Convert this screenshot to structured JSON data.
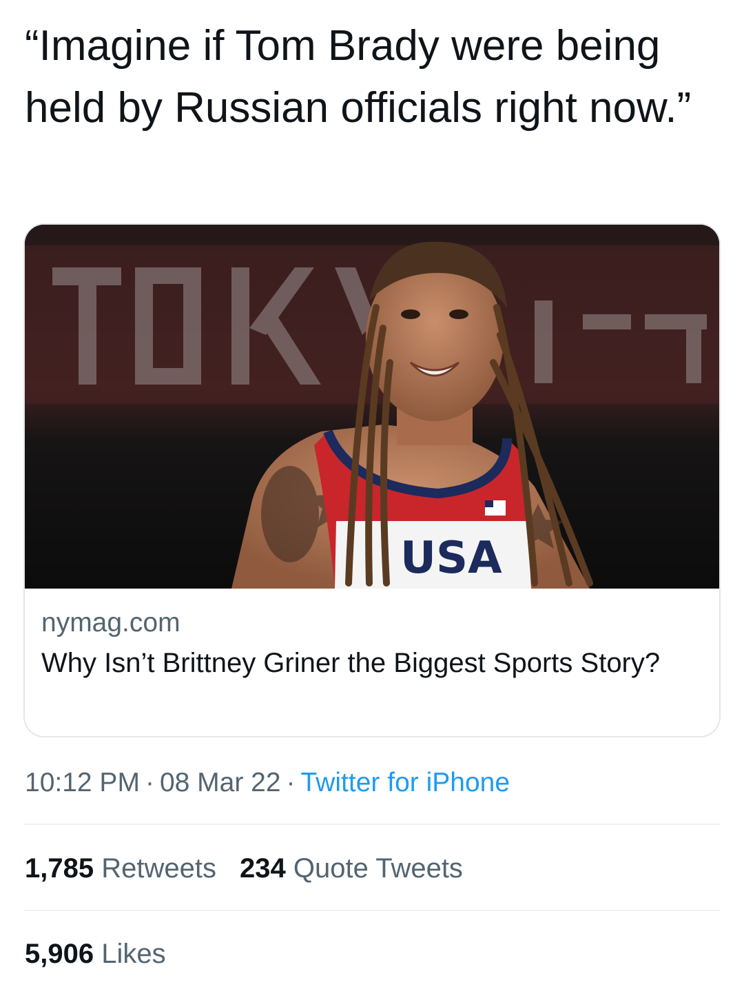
{
  "tweet": {
    "text": "“Imagine if Tom Brady were being held by Russian officials right now.”"
  },
  "card": {
    "image_alt": "Brittney Griner in USA jersey",
    "domain": "nymag.com",
    "title": "Why Isn’t Brittney Griner the Biggest Sports Story?"
  },
  "meta": {
    "time": "10:12 PM",
    "separator": "·",
    "date": "08 Mar 22",
    "source": "Twitter for iPhone"
  },
  "stats": {
    "retweets": {
      "count": "1,785",
      "label": "Retweets"
    },
    "quotes": {
      "count": "234",
      "label": "Quote Tweets"
    },
    "likes": {
      "count": "5,906",
      "label": "Likes"
    }
  },
  "colors": {
    "text": "#0f1419",
    "secondary": "#536471",
    "link": "#1d9bf0",
    "border": "#e3e7ea"
  }
}
